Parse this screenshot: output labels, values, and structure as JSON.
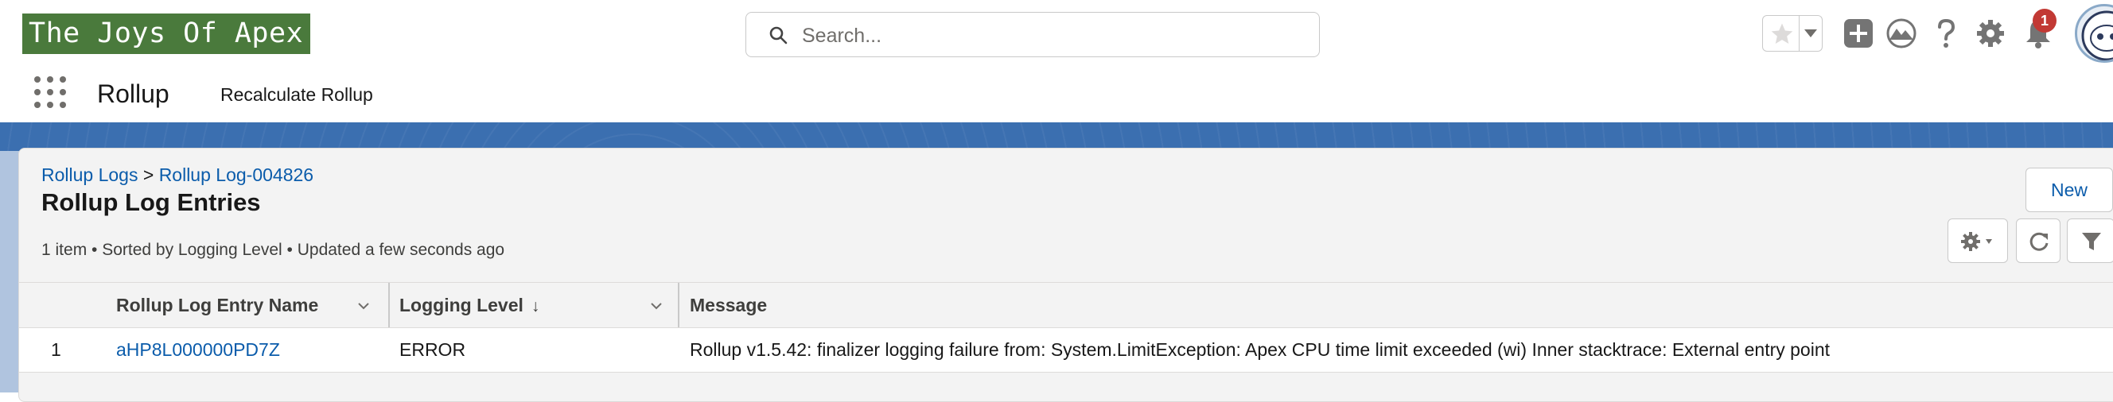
{
  "header": {
    "logo_text": "The Joys Of Apex",
    "search_placeholder": "Search...",
    "notification_count": "1"
  },
  "app_nav": {
    "app_name": "Rollup",
    "items": [
      "Recalculate Rollup"
    ]
  },
  "list_view": {
    "breadcrumb": {
      "parent": "Rollup Logs",
      "separator": ">",
      "record": "Rollup Log-004826"
    },
    "title": "Rollup Log Entries",
    "meta": "1 item • Sorted by Logging Level • Updated a few seconds ago",
    "new_button": "New",
    "columns": [
      "Rollup Log Entry Name",
      "Logging Level",
      "Message"
    ],
    "sort_indicator": "↓",
    "rows": [
      {
        "number": "1",
        "name": "aHP8L000000PD7Z",
        "level": "ERROR",
        "message": "Rollup v1.5.42: finalizer logging failure from: System.LimitException: Apex CPU time limit exceeded (wi) Inner stacktrace: External entry point"
      }
    ]
  },
  "colors": {
    "brand_blue": "#3b6fb0",
    "link": "#0b5cab",
    "logo_bg": "#4a7a3c",
    "badge": "#c23934"
  },
  "icons": [
    "search-icon",
    "star-icon",
    "add-icon",
    "trailhead-icon",
    "help-icon",
    "gear-icon",
    "bell-icon",
    "app-launcher-icon",
    "refresh-icon",
    "filter-icon"
  ]
}
